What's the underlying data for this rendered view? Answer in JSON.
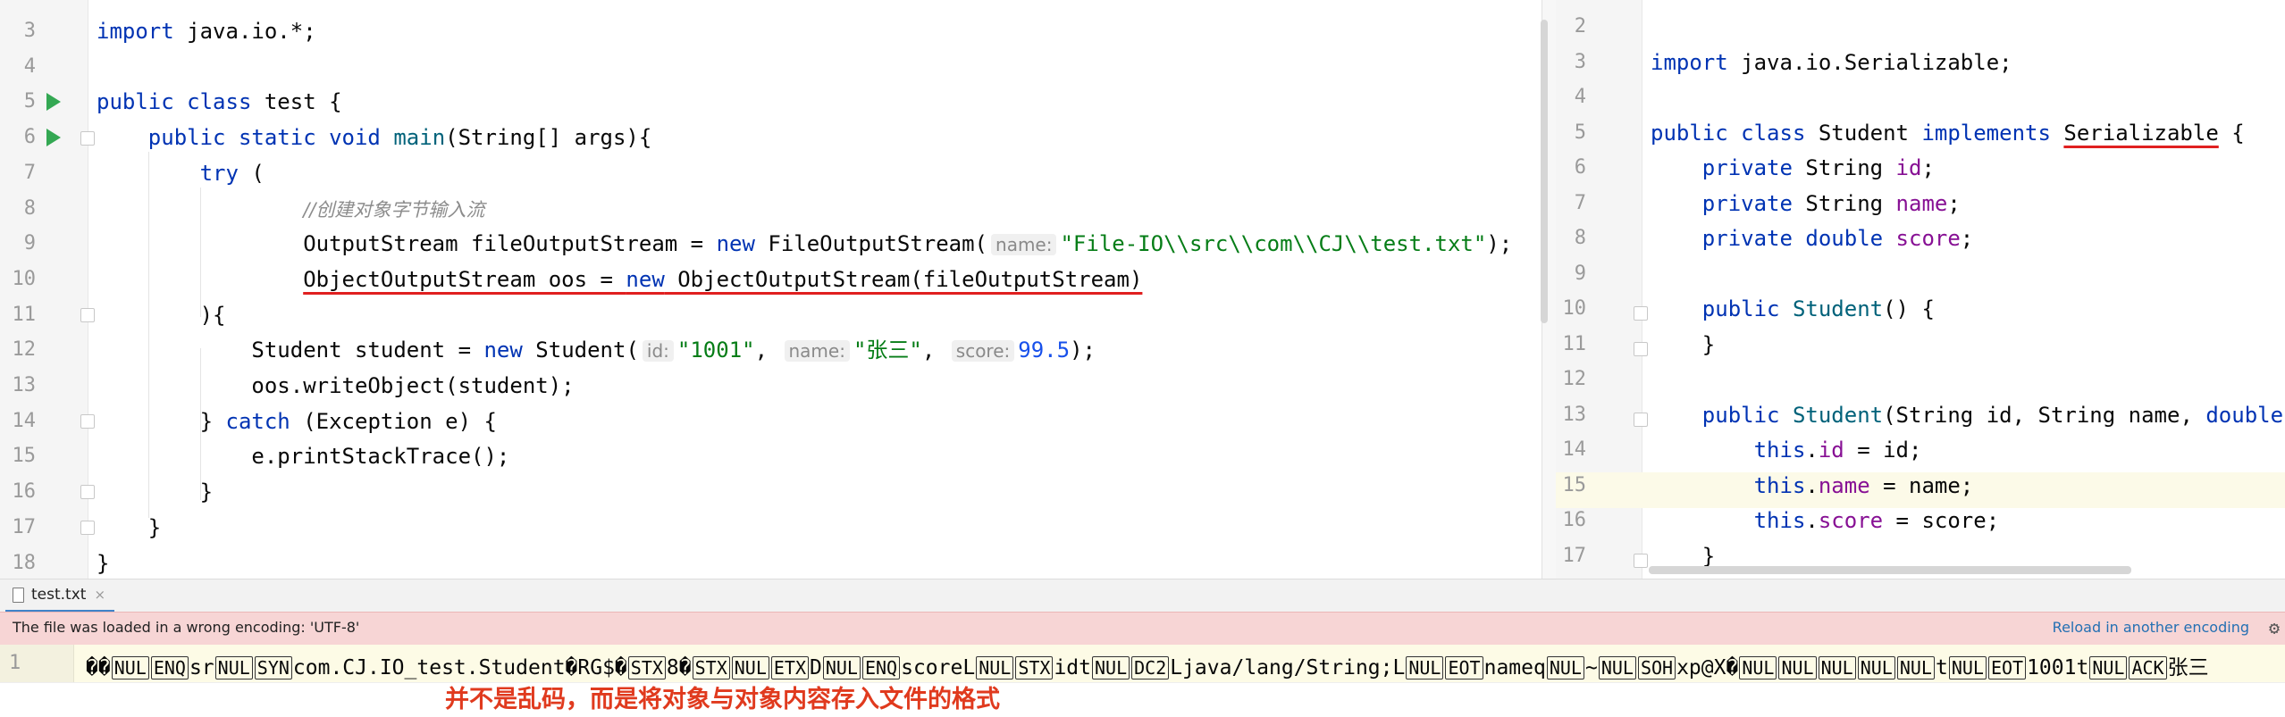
{
  "left_editor": {
    "lines": [
      {
        "n": "3",
        "parts": [
          {
            "t": "import",
            "c": "kw"
          },
          {
            "t": " java.io.*;"
          }
        ]
      },
      {
        "n": "4",
        "parts": []
      },
      {
        "n": "5",
        "parts": [
          {
            "t": "public",
            "c": "kw"
          },
          {
            "t": " "
          },
          {
            "t": "class",
            "c": "kw"
          },
          {
            "t": " test {"
          }
        ]
      },
      {
        "n": "6",
        "parts": [
          {
            "t": "    "
          },
          {
            "t": "public static void",
            "c": "kw"
          },
          {
            "t": " "
          },
          {
            "t": "main",
            "c": "fn"
          },
          {
            "t": "(String[] args){"
          }
        ]
      },
      {
        "n": "7",
        "parts": [
          {
            "t": "        "
          },
          {
            "t": "try",
            "c": "kw"
          },
          {
            "t": " ("
          }
        ]
      },
      {
        "n": "8",
        "parts": [
          {
            "t": "                "
          },
          {
            "t": "//创建对象字节输入流",
            "c": "cmt"
          }
        ]
      },
      {
        "n": "9",
        "parts": [
          {
            "t": "                OutputStream fileOutputStream = "
          },
          {
            "t": "new",
            "c": "kw"
          },
          {
            "t": " FileOutputStream("
          },
          {
            "t": "name:",
            "c": "hint"
          },
          {
            "t": "\"File-IO\\\\src\\\\com\\\\CJ\\\\test.txt\"",
            "c": "str"
          },
          {
            "t": ");"
          }
        ]
      },
      {
        "n": "10",
        "parts": [
          {
            "t": "                "
          },
          {
            "t": "ObjectOutputStream oos = ",
            "c": "redline"
          },
          {
            "t": "new",
            "c": "kw redline"
          },
          {
            "t": " ObjectOutputStream(fileOutputStream)",
            "c": "redline"
          }
        ]
      },
      {
        "n": "11",
        "parts": [
          {
            "t": "        ){"
          }
        ]
      },
      {
        "n": "12",
        "parts": [
          {
            "t": "            Student student = "
          },
          {
            "t": "new",
            "c": "kw"
          },
          {
            "t": " Student("
          },
          {
            "t": "id:",
            "c": "hint"
          },
          {
            "t": "\"1001\"",
            "c": "str"
          },
          {
            "t": ", "
          },
          {
            "t": "name:",
            "c": "hint"
          },
          {
            "t": "\"张三\"",
            "c": "str"
          },
          {
            "t": ", "
          },
          {
            "t": "score:",
            "c": "hint"
          },
          {
            "t": "99.5",
            "c": "num"
          },
          {
            "t": ");"
          }
        ]
      },
      {
        "n": "13",
        "parts": [
          {
            "t": "            oos.writeObject(student);"
          }
        ]
      },
      {
        "n": "14",
        "parts": [
          {
            "t": "        } "
          },
          {
            "t": "catch",
            "c": "kw"
          },
          {
            "t": " (Exception e) {"
          }
        ]
      },
      {
        "n": "15",
        "parts": [
          {
            "t": "            e.printStackTrace();"
          }
        ]
      },
      {
        "n": "16",
        "parts": [
          {
            "t": "        }"
          }
        ]
      },
      {
        "n": "17",
        "parts": [
          {
            "t": "    }"
          }
        ]
      },
      {
        "n": "18",
        "parts": [
          {
            "t": "}"
          }
        ]
      }
    ]
  },
  "right_editor": {
    "lines": [
      {
        "n": "2",
        "parts": []
      },
      {
        "n": "3",
        "parts": [
          {
            "t": "import",
            "c": "kw"
          },
          {
            "t": " java.io.Serializable;"
          }
        ]
      },
      {
        "n": "4",
        "parts": []
      },
      {
        "n": "5",
        "parts": [
          {
            "t": "public class",
            "c": "kw"
          },
          {
            "t": " Student "
          },
          {
            "t": "implements",
            "c": "kw"
          },
          {
            "t": " "
          },
          {
            "t": "Serializable",
            "c": "redline"
          },
          {
            "t": " {"
          }
        ]
      },
      {
        "n": "6",
        "parts": [
          {
            "t": "    "
          },
          {
            "t": "private",
            "c": "kw"
          },
          {
            "t": " String "
          },
          {
            "t": "id",
            "c": "fld"
          },
          {
            "t": ";"
          }
        ]
      },
      {
        "n": "7",
        "parts": [
          {
            "t": "    "
          },
          {
            "t": "private",
            "c": "kw"
          },
          {
            "t": " String "
          },
          {
            "t": "name",
            "c": "fld"
          },
          {
            "t": ";"
          }
        ]
      },
      {
        "n": "8",
        "parts": [
          {
            "t": "    "
          },
          {
            "t": "private double",
            "c": "kw"
          },
          {
            "t": " "
          },
          {
            "t": "score",
            "c": "fld"
          },
          {
            "t": ";"
          }
        ]
      },
      {
        "n": "9",
        "parts": []
      },
      {
        "n": "10",
        "parts": [
          {
            "t": "    "
          },
          {
            "t": "public",
            "c": "kw"
          },
          {
            "t": " "
          },
          {
            "t": "Student",
            "c": "fn"
          },
          {
            "t": "() {"
          }
        ]
      },
      {
        "n": "11",
        "parts": [
          {
            "t": "    }"
          }
        ]
      },
      {
        "n": "12",
        "parts": []
      },
      {
        "n": "13",
        "parts": [
          {
            "t": "    "
          },
          {
            "t": "public",
            "c": "kw"
          },
          {
            "t": " "
          },
          {
            "t": "Student",
            "c": "fn"
          },
          {
            "t": "(String id, String name, "
          },
          {
            "t": "double",
            "c": "kw"
          }
        ]
      },
      {
        "n": "14",
        "parts": [
          {
            "t": "        "
          },
          {
            "t": "this",
            "c": "kw"
          },
          {
            "t": "."
          },
          {
            "t": "id",
            "c": "fld"
          },
          {
            "t": " = id;"
          }
        ]
      },
      {
        "n": "15",
        "parts": [
          {
            "t": "        "
          },
          {
            "t": "this",
            "c": "kw"
          },
          {
            "t": "."
          },
          {
            "t": "name",
            "c": "fld"
          },
          {
            "t": " = name;"
          }
        ]
      },
      {
        "n": "16",
        "parts": [
          {
            "t": "        "
          },
          {
            "t": "this",
            "c": "kw"
          },
          {
            "t": "."
          },
          {
            "t": "score",
            "c": "fld"
          },
          {
            "t": " = score;"
          }
        ]
      },
      {
        "n": "17",
        "parts": [
          {
            "t": "    }"
          }
        ]
      }
    ]
  },
  "tab": {
    "file_name": "test.txt",
    "close": "×"
  },
  "warning": {
    "message": "The file was loaded in a wrong encoding: 'UTF-8'",
    "action": "Reload in another encoding"
  },
  "file_view": {
    "line_number": "1",
    "content": [
      {
        "t": "��"
      },
      {
        "t": "NUL",
        "c": "ctl"
      },
      {
        "t": "ENQ",
        "c": "ctl"
      },
      {
        "t": "sr"
      },
      {
        "t": "NUL",
        "c": "ctl"
      },
      {
        "t": "SYN",
        "c": "ctl"
      },
      {
        "t": "com.CJ.IO_test.Student�RG$�"
      },
      {
        "t": "STX",
        "c": "ctl"
      },
      {
        "t": "8�"
      },
      {
        "t": "STX",
        "c": "ctl"
      },
      {
        "t": "NUL",
        "c": "ctl"
      },
      {
        "t": "ETX",
        "c": "ctl"
      },
      {
        "t": "D"
      },
      {
        "t": "NUL",
        "c": "ctl"
      },
      {
        "t": "ENQ",
        "c": "ctl"
      },
      {
        "t": "scoreL"
      },
      {
        "t": "NUL",
        "c": "ctl"
      },
      {
        "t": "STX",
        "c": "ctl"
      },
      {
        "t": "idt"
      },
      {
        "t": "NUL",
        "c": "ctl"
      },
      {
        "t": "DC2",
        "c": "ctl"
      },
      {
        "t": "Ljava/lang/String;L"
      },
      {
        "t": "NUL",
        "c": "ctl"
      },
      {
        "t": "EOT",
        "c": "ctl"
      },
      {
        "t": "nameq"
      },
      {
        "t": "NUL",
        "c": "ctl"
      },
      {
        "t": "~"
      },
      {
        "t": "NUL",
        "c": "ctl"
      },
      {
        "t": "SOH",
        "c": "ctl"
      },
      {
        "t": "xp@X�"
      },
      {
        "t": "NUL",
        "c": "ctl"
      },
      {
        "t": "NUL",
        "c": "ctl"
      },
      {
        "t": "NUL",
        "c": "ctl"
      },
      {
        "t": "NUL",
        "c": "ctl"
      },
      {
        "t": "NUL",
        "c": "ctl"
      },
      {
        "t": "t"
      },
      {
        "t": "NUL",
        "c": "ctl"
      },
      {
        "t": "EOT",
        "c": "ctl"
      },
      {
        "t": "1001t"
      },
      {
        "t": "NUL",
        "c": "ctl"
      },
      {
        "t": "ACK",
        "c": "ctl"
      },
      {
        "t": "张三"
      }
    ]
  },
  "annotation": "并不是乱码，而是将对象与对象内容存入文件的格式"
}
